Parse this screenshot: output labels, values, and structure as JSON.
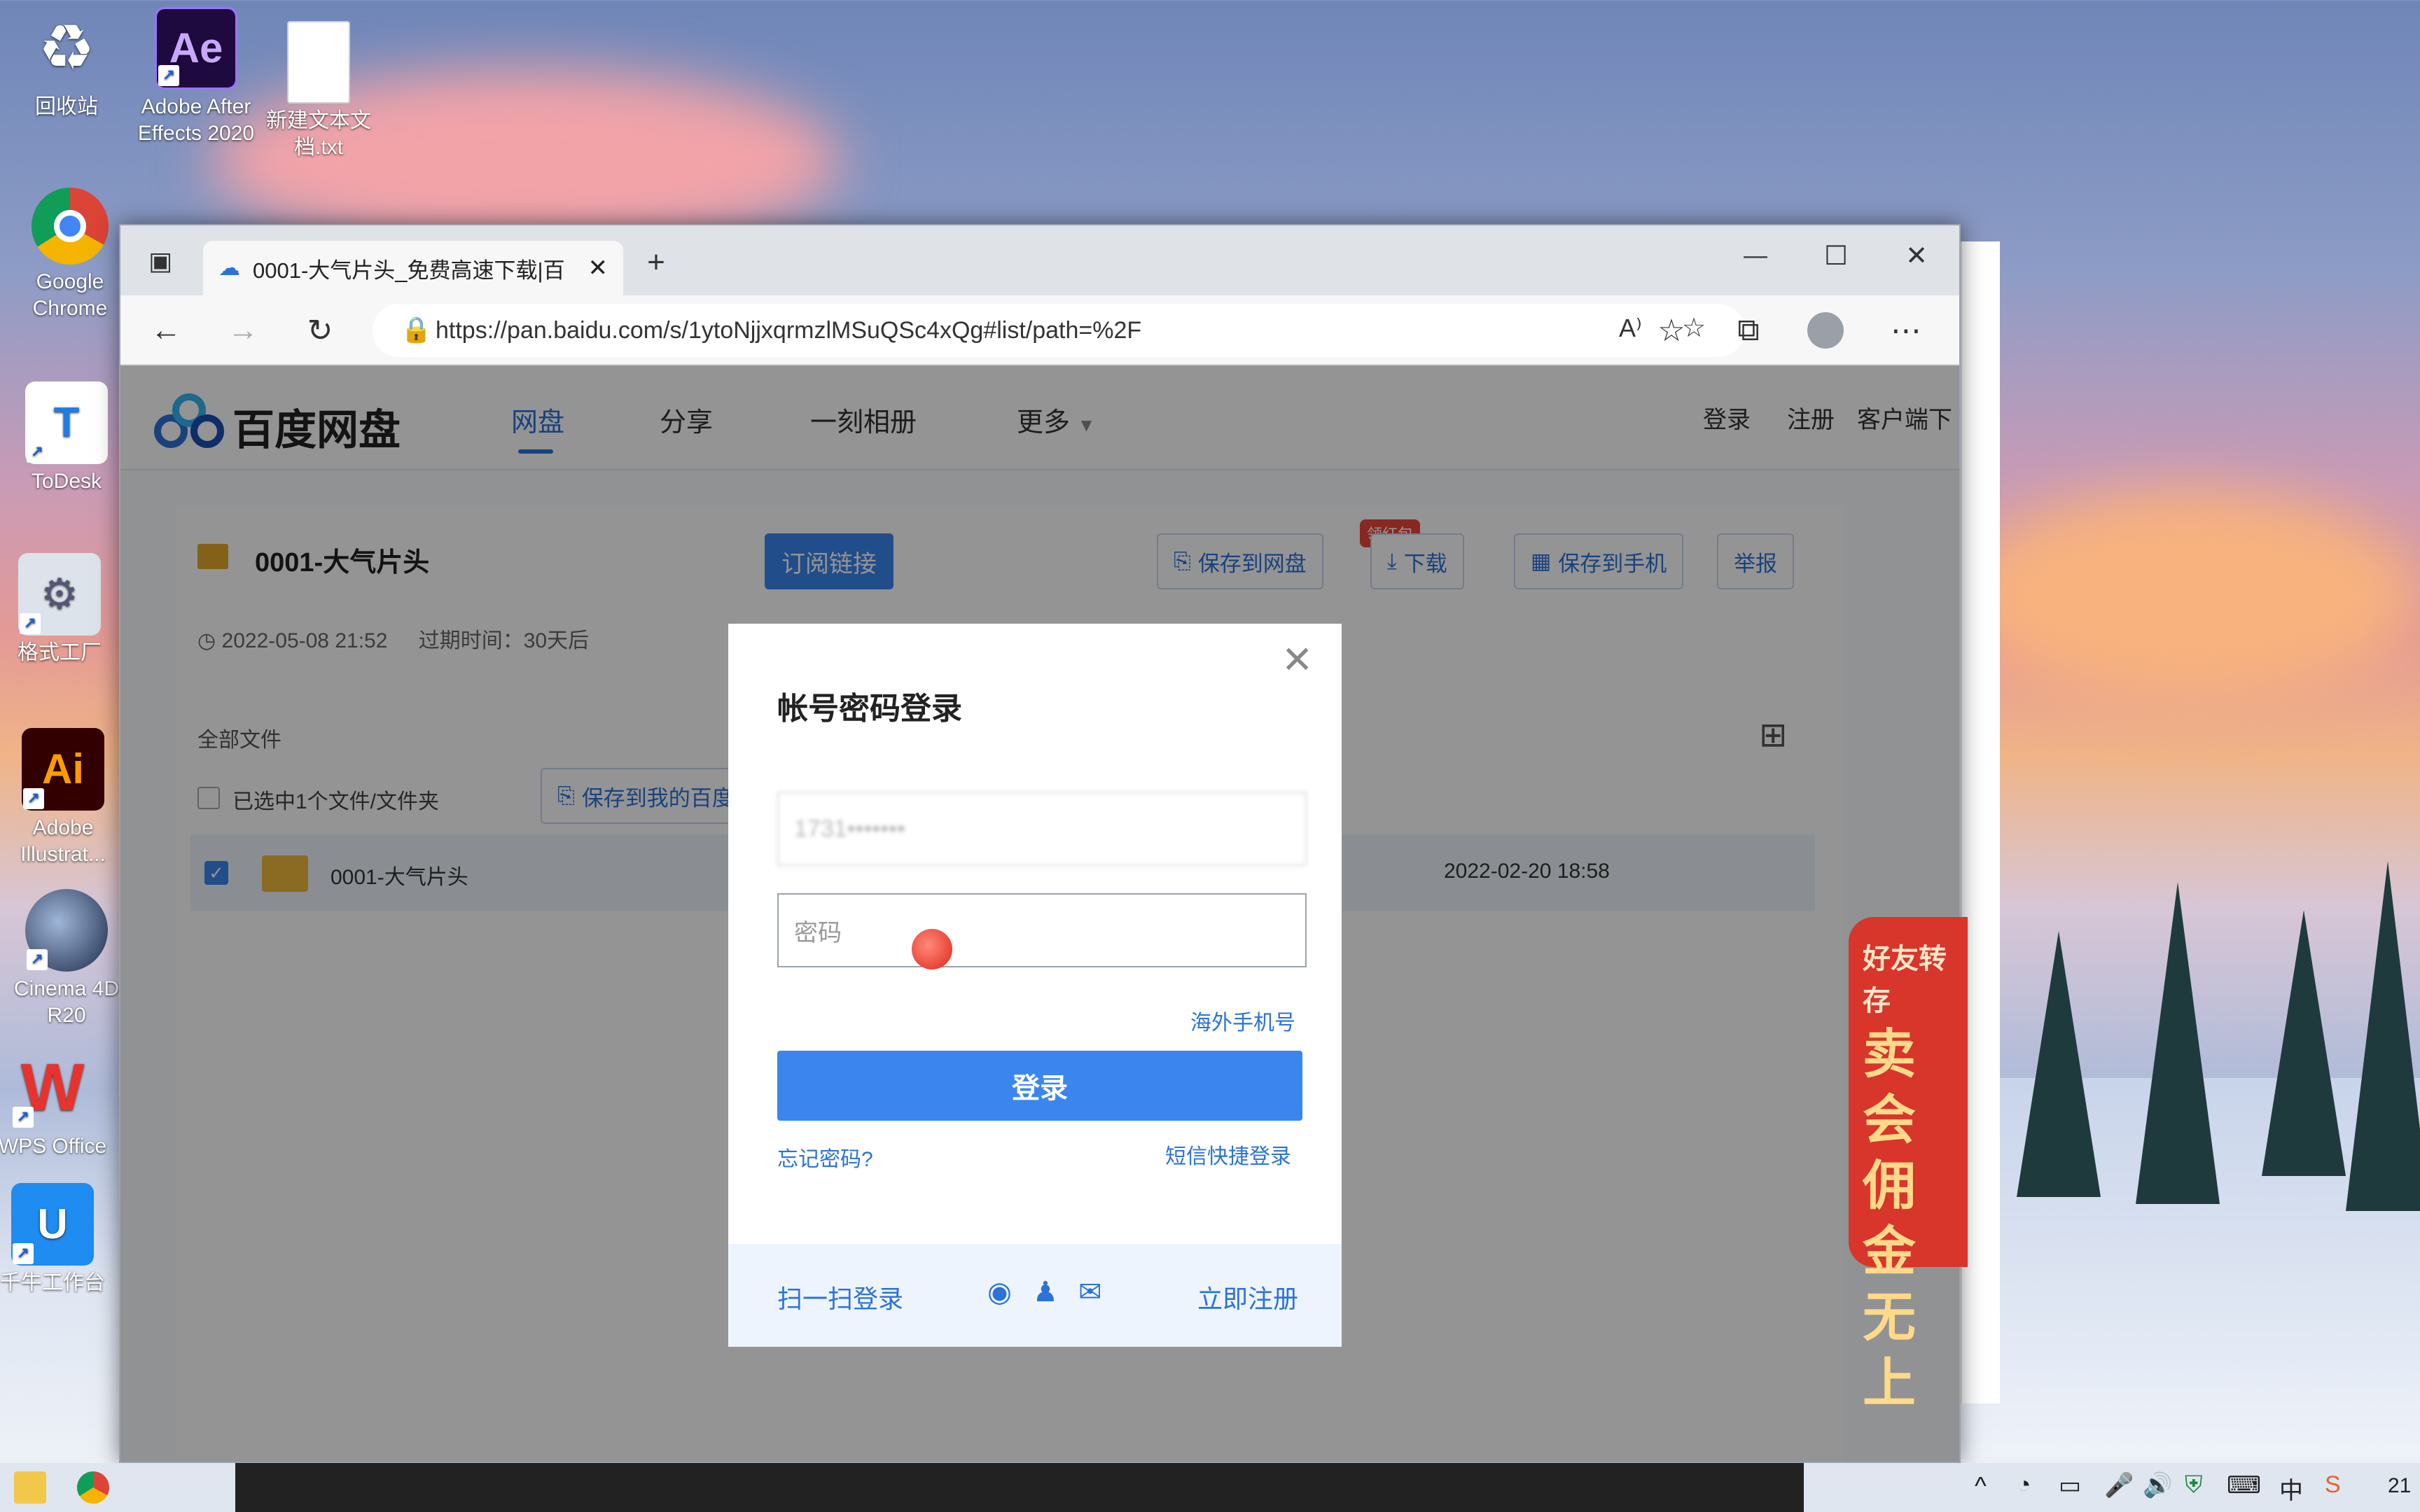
{
  "desktop": {
    "icons": [
      {
        "label": "回收站",
        "glyph": "♻"
      },
      {
        "label": "Adobe After Effects 2020",
        "glyph": "Ae"
      },
      {
        "label": "新建文本文档.txt",
        "glyph": ""
      },
      {
        "label": "Google Chrome",
        "glyph": ""
      },
      {
        "label": "ToDesk",
        "glyph": "T"
      },
      {
        "label": "格式工厂",
        "glyph": "⚙"
      },
      {
        "label": "Adobe Illustrat...",
        "glyph": "Ai"
      },
      {
        "label": "Cinema 4D R20",
        "glyph": ""
      },
      {
        "label": "WPS Office",
        "glyph": "W"
      },
      {
        "label": "千牛工作台",
        "glyph": "U"
      }
    ]
  },
  "browser": {
    "tab_title": "0001-大气片头_免费高速下载|百",
    "url": "https://pan.baidu.com/s/1ytoNjjxqrmzlMSuQSc4xQg#list/path=%2F",
    "read_aloud_icon": "A⁾"
  },
  "site": {
    "logo_text": "百度网盘",
    "nav": [
      "网盘",
      "分享",
      "一刻相册",
      "更多"
    ],
    "right_links": [
      "登录",
      "注册",
      "客户端下"
    ],
    "folder_title": "0001-大气片头",
    "subscribe_button": "订阅链接",
    "save_badge": "领红包",
    "actions": [
      "保存到网盘",
      "下载",
      "保存到手机",
      "举报"
    ],
    "created": "2022-05-08 21:52",
    "expire": "过期时间：30天后",
    "all_files": "全部文件",
    "selected_text": "已选中1个文件/文件夹",
    "save_my_button": "保存到我的百度网",
    "file_name": "0001-大气片头",
    "file_date": "2022-02-20 18:58",
    "ad_text": [
      "好友转存",
      "卖会",
      "佣金",
      "无上"
    ]
  },
  "login_modal": {
    "title": "帐号密码登录",
    "username_value": "1731•••••••",
    "password_placeholder": "密码",
    "overseas_link": "海外手机号",
    "login_button": "登录",
    "forgot_link": "忘记密码?",
    "sms_link": "短信快捷登录",
    "qr_link": "扫一扫登录",
    "register_link": "立即注册"
  },
  "taskbar": {
    "clock": "21"
  },
  "colors": {
    "accent": "#3a86ee",
    "link": "#2b73d8",
    "ad_red": "#d8352b"
  }
}
